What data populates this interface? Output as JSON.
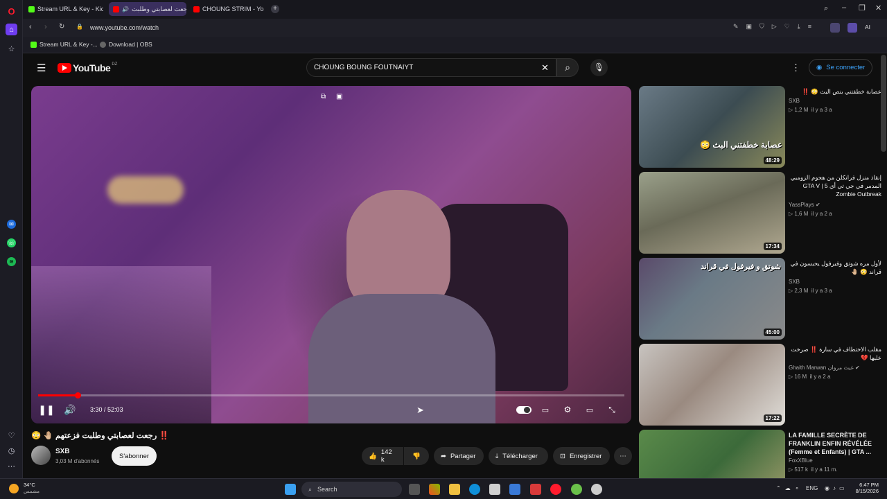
{
  "browser": {
    "tabs": [
      {
        "label": "Stream URL & Key - Kick D"
      },
      {
        "label": "رجعت لعصابتي وطلبت"
      },
      {
        "label": "CHOUNG STRIM - YouTub"
      }
    ],
    "address": "www.youtube.com/watch",
    "bookmarks": [
      {
        "label": "Stream URL & Key -..."
      },
      {
        "label": "Download | OBS"
      }
    ],
    "ai_label": "AI"
  },
  "youtube": {
    "logo_text": "YouTube",
    "country": "DZ",
    "search_value": "CHOUNG BOUNG FOUTNAIYT",
    "signin_label": "Se connecter",
    "player": {
      "time_current": "3:30",
      "time_total": "52:03",
      "progress": 0.067
    },
    "video_title": "‼️ رجعت لعصابتي وطلبت فزعتهم 🤚🏼 😳",
    "channel": {
      "name": "SXB",
      "subscribers": "3,03 M d'abonnés",
      "subscribe_label": "S'abonner"
    },
    "actions": {
      "likes": "142 k",
      "share": "Partager",
      "download": "Télécharger",
      "save": "Enregistrer"
    },
    "recommendations": [
      {
        "title": "عصابة خطفتني بنص البث 😳 ‼️",
        "channel": "SXB",
        "views": "1,2 M",
        "age": "il y a 3 a",
        "duration": "48:29",
        "rtl": true,
        "thumb_text": "عصابة خطفتني البث 😳"
      },
      {
        "title": "إنقاذ منزل فرانكلن من هجوم الزومبي المدمر في جي تي أي GTA V | 5 Zombie Outbreak",
        "channel": "YassPlays",
        "views": "1,6 M",
        "age": "il y a 2 a",
        "duration": "17:34",
        "rtl": true,
        "verified": true
      },
      {
        "title": "لأول مره شوتق وفيرفول يحبسون في قراند 😳 🤚🏼",
        "channel": "SXB",
        "views": "2,3 M",
        "age": "il y a 3 a",
        "duration": "45:00",
        "rtl": true,
        "thumb_text": "شوتق و فيرفول في قراند"
      },
      {
        "title": "مقلب الاختطاف في سارة ‼️ صرخت عليها 💔",
        "channel": "Ghaith Marwan غيث مروان",
        "views": "16 M",
        "age": "il y a 2 a",
        "duration": "17:22",
        "rtl": true,
        "verified": true
      },
      {
        "title": "LA FAMILLE SECRÈTE DE FRANKLIN ENFIN RÉVÉLÉE (Femme et Enfants) | GTA ...",
        "channel": "FoxXBlue",
        "views": "517 k",
        "age": "il y a 11 m.",
        "duration": "",
        "rtl": false
      }
    ]
  },
  "taskbar": {
    "weather_temp": "34°C",
    "weather_desc": "مشمس",
    "search_label": "Search",
    "lang": "ENG",
    "time": "6:47 PM",
    "date": "8/15/2026"
  }
}
